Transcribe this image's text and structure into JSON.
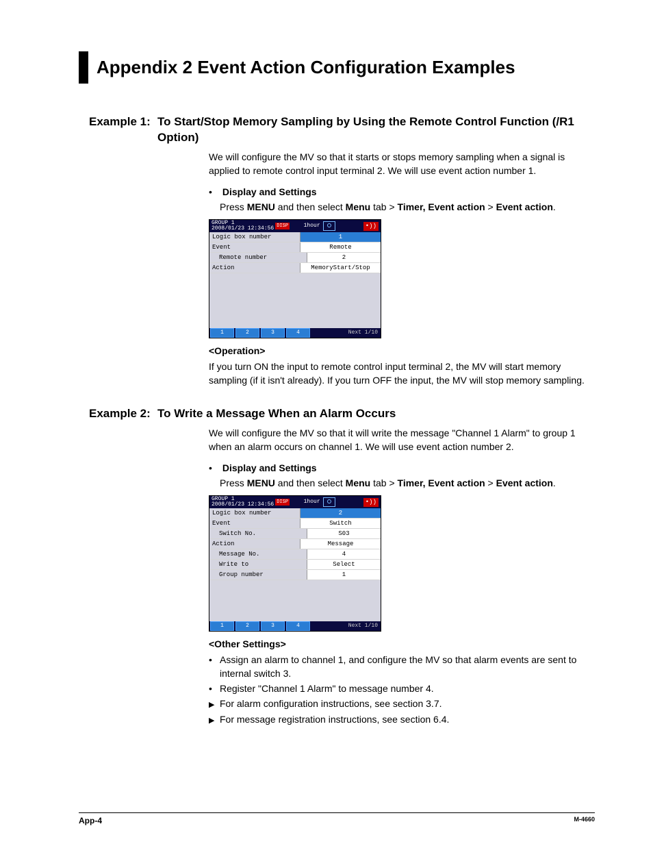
{
  "title": "Appendix 2   Event Action Configuration Examples",
  "example1": {
    "heading_label": "Example 1:",
    "heading_text": "To Start/Stop Memory Sampling by Using the Remote Control Function (/R1 Option)",
    "intro": "We will configure the MV so that it starts or stops memory sampling when a signal is applied to remote control input terminal 2. We will use event action number 1.",
    "ds_label": "Display and Settings",
    "press_prefix": "Press ",
    "press_menu": "MENU",
    "press_mid1": " and then select ",
    "press_menu_tab": "Menu",
    "press_tab_word": " tab > ",
    "press_timer": "Timer, Event action",
    "press_gt": " > ",
    "press_event": "Event action",
    "press_dot": ".",
    "shot": {
      "group": "GROUP 1",
      "datetime": "2008/01/23 12:34:56",
      "disp": "DISP",
      "hour": "1hour",
      "snd": "•))",
      "rows": [
        {
          "label": "Logic box number",
          "value": "1",
          "selected": true,
          "indent": false
        },
        {
          "label": "Event",
          "value": "Remote",
          "selected": false,
          "indent": false
        },
        {
          "label": "Remote number",
          "value": "2",
          "selected": false,
          "indent": true
        },
        {
          "label": "Action",
          "value": "MemoryStart/Stop",
          "selected": false,
          "indent": false
        }
      ],
      "softkeys": [
        "1",
        "2",
        "3",
        "4"
      ],
      "next": "Next 1/10"
    },
    "op_head": "<Operation>",
    "op_text": "If you turn ON the input to remote control input terminal 2, the MV will start memory sampling (if it isn't already). If you turn OFF the input, the MV will stop memory sampling."
  },
  "example2": {
    "heading_label": "Example 2:",
    "heading_text": "To Write a Message When an Alarm Occurs",
    "intro": "We will configure the MV so that it will write the message \"Channel 1 Alarm\" to group 1 when an alarm occurs on channel 1. We will use event action number 2.",
    "ds_label": "Display and Settings",
    "shot": {
      "group": "GROUP 1",
      "datetime": "2008/01/23 12:34:56",
      "disp": "DISP",
      "hour": "1hour",
      "snd": "•))",
      "rows": [
        {
          "label": "Logic box number",
          "value": "2",
          "selected": true,
          "indent": false
        },
        {
          "label": "Event",
          "value": "Switch",
          "selected": false,
          "indent": false
        },
        {
          "label": "Switch No.",
          "value": "S03",
          "selected": false,
          "indent": true
        },
        {
          "label": "Action",
          "value": "Message",
          "selected": false,
          "indent": false
        },
        {
          "label": "Message No.",
          "value": "4",
          "selected": false,
          "indent": true
        },
        {
          "label": "Write to",
          "value": "Select",
          "selected": false,
          "indent": true
        },
        {
          "label": "Group number",
          "value": "1",
          "selected": false,
          "indent": true
        }
      ],
      "softkeys": [
        "1",
        "2",
        "3",
        "4"
      ],
      "next": "Next 1/10"
    },
    "other_head": "<Other Settings>",
    "bullets": [
      "Assign an alarm to channel 1, and configure the MV so that alarm events are sent to internal switch 3.",
      "Register \"Channel 1 Alarm\" to message number 4."
    ],
    "refs": [
      "For alarm configuration instructions, see section 3.7.",
      "For message registration instructions, see section 6.4."
    ]
  },
  "footer": {
    "page": "App-4",
    "doc": "M-4660"
  }
}
